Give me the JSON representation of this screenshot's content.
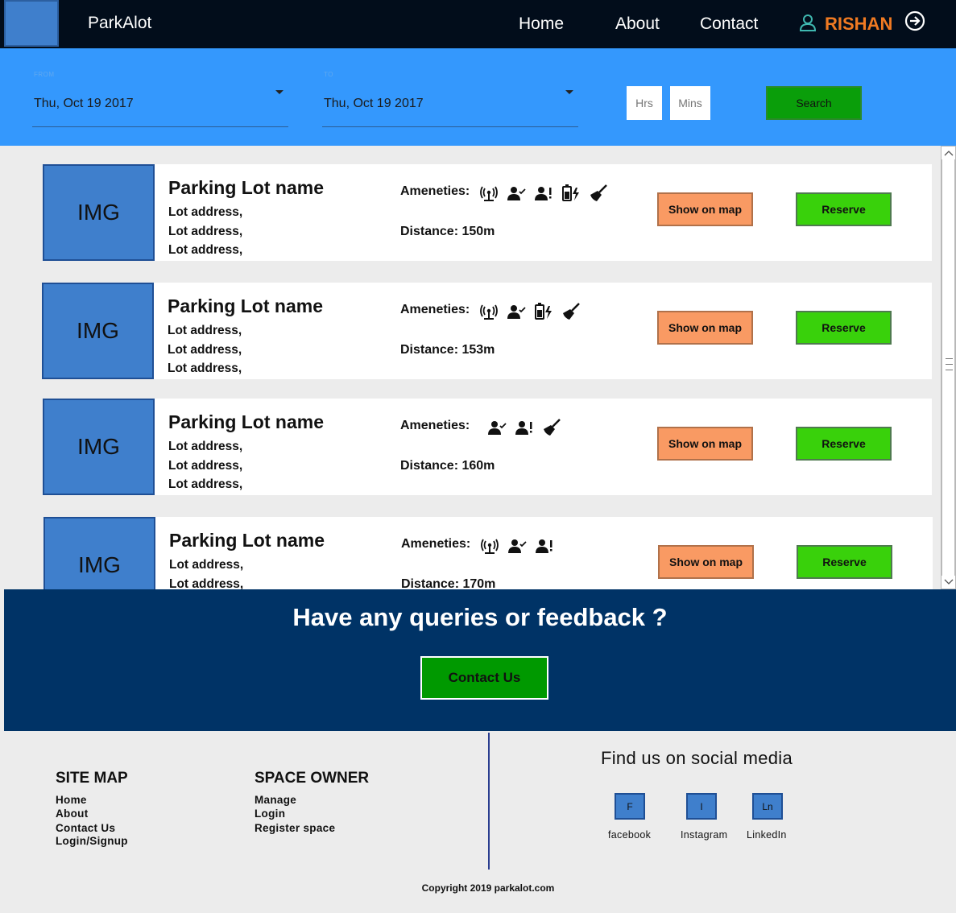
{
  "nav": {
    "brand": "ParkAlot",
    "links": [
      "Home",
      "About",
      "Contact"
    ],
    "user_name": "RISHAN",
    "user_icon": "user-icon",
    "logout_icon": "logout-icon"
  },
  "search": {
    "from_caption": "FROM",
    "from_value": "Thu, Oct 19 2017",
    "to_caption": "TO",
    "to_value": "Thu, Oct 19 2017",
    "hrs_placeholder": "Hrs",
    "mins_placeholder": "Mins",
    "search_label": "Search"
  },
  "results": [
    {
      "img": "IMG",
      "name": "Parking Lot name",
      "address": [
        "Lot address,",
        "Lot address,",
        "Lot address,"
      ],
      "amenities_label": "Ameneties:",
      "amenities": [
        "wifi",
        "attendant",
        "alert",
        "ev-charging",
        "cleaning"
      ],
      "distance_label": "Distance:",
      "distance": "150m",
      "map_label": "Show on map",
      "reserve_label": "Reserve"
    },
    {
      "img": "IMG",
      "name": "Parking Lot name",
      "address": [
        "Lot address,",
        "Lot address,",
        "Lot address,"
      ],
      "amenities_label": "Ameneties:",
      "amenities": [
        "wifi",
        "attendant",
        "ev-charging",
        "cleaning"
      ],
      "distance_label": "Distance:",
      "distance": "153m",
      "map_label": "Show on map",
      "reserve_label": "Reserve"
    },
    {
      "img": "IMG",
      "name": "Parking Lot name",
      "address": [
        "Lot address,",
        "Lot address,",
        "Lot address,"
      ],
      "amenities_label": "Ameneties:",
      "amenities": [
        "attendant",
        "alert",
        "cleaning"
      ],
      "distance_label": "Distance:",
      "distance": "160m",
      "map_label": "Show on map",
      "reserve_label": "Reserve"
    },
    {
      "img": "IMG",
      "name": "Parking Lot name",
      "address": [
        "Lot address,",
        "Lot address,"
      ],
      "amenities_label": "Ameneties:",
      "amenities": [
        "wifi",
        "attendant",
        "alert"
      ],
      "distance_label": "Distance:",
      "distance": "170m",
      "map_label": "Show on map",
      "reserve_label": "Reserve"
    }
  ],
  "feedback": {
    "title": "Have any queries or feedback ?",
    "button": "Contact Us"
  },
  "footer": {
    "sitemap_title": "SITE MAP",
    "sitemap_links": [
      "Home",
      "About",
      "Contact Us",
      "Login/Signup"
    ],
    "owner_title": "SPACE OWNER",
    "owner_links": [
      "Manage",
      "Login",
      "Register space"
    ],
    "social_title": "Find us on social media",
    "social": [
      {
        "letter": "F",
        "label": "facebook"
      },
      {
        "letter": "I",
        "label": "Instagram"
      },
      {
        "letter": "Ln",
        "label": "LinkedIn"
      }
    ],
    "copyright": "Copyright 2019 parkalot.com"
  },
  "colors": {
    "navbar": "#020d1b",
    "search_bar": "#3498fd",
    "accent_user": "#f07a22",
    "map_button": "#f99a63",
    "reserve_button": "#39d10b",
    "feedback_band": "#003366",
    "image_placeholder": "#3f7fcc"
  }
}
